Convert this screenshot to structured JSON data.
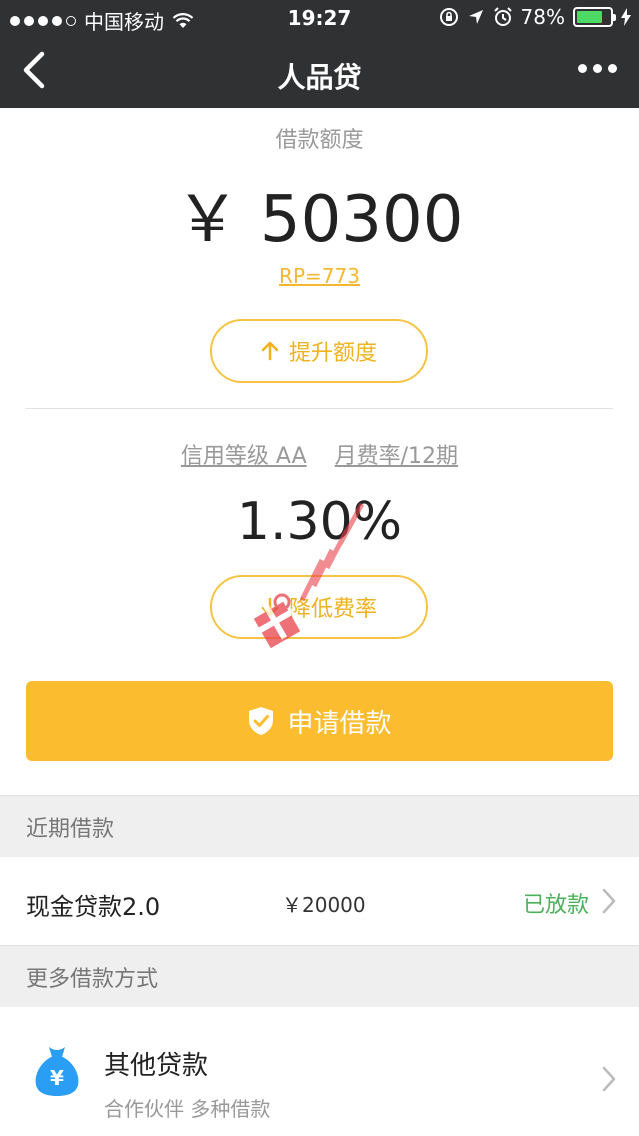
{
  "status_bar": {
    "carrier": "中国移动",
    "time": "19:27",
    "battery": "78%"
  },
  "nav": {
    "title": "人品贷"
  },
  "credit": {
    "label": "借款额度",
    "amount": "￥ 50300",
    "rp": "RP=773",
    "raise_button": "提升额度",
    "credit_level": "信用等级 AA",
    "monthly_rate_label": "月费率/12期",
    "rate": "1.30%",
    "lower_button": "降低费率"
  },
  "apply_button": "申请借款",
  "recent": {
    "header": "近期借款",
    "item": {
      "name": "现金贷款2.0",
      "amount": "￥20000",
      "status": "已放款"
    }
  },
  "more": {
    "header": "更多借款方式",
    "item": {
      "title": "其他贷款",
      "subtitle": "合作伙伴 多种借款"
    }
  },
  "colors": {
    "accent": "#fbbd2f",
    "nav_bg": "#2f3133",
    "success": "#4cb05a",
    "icon_blue": "#2a9df4"
  }
}
